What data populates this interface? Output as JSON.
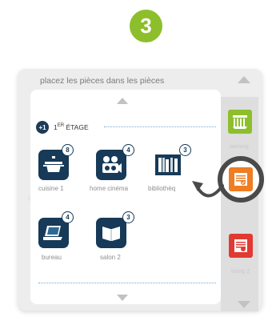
{
  "step": {
    "number": "3"
  },
  "panel": {
    "title": "placez les pièces dans les pièces"
  },
  "floor": {
    "badge": "+1",
    "label_prefix": "1",
    "label_sup": "ER",
    "label_suffix": " ÉTAGE"
  },
  "rooms": [
    {
      "label": "cuisine 1",
      "count": "8",
      "icon": "cooking-pot-icon"
    },
    {
      "label": "home cinéma",
      "count": "4",
      "icon": "projector-icon"
    },
    {
      "label": "bibliothèq",
      "count": "3",
      "icon": "bookshelf-icon"
    },
    {
      "label": "bureau",
      "count": "4",
      "icon": "laptop-icon"
    },
    {
      "label": "salon 2",
      "count": "3",
      "icon": "open-book-icon"
    }
  ],
  "devices": [
    {
      "label": "awning",
      "color": "#8cbf2b",
      "icon": "awning-icon"
    },
    {
      "label": "",
      "color": "#ef7d22",
      "icon": "shutter-icon"
    },
    {
      "label": "living 2",
      "color": "#e03a33",
      "icon": "shutter-icon"
    }
  ],
  "colors": {
    "accent": "#8cbf2b",
    "room_icon_bg": "#163a57",
    "drag_arrow": "#4a4a4a"
  }
}
